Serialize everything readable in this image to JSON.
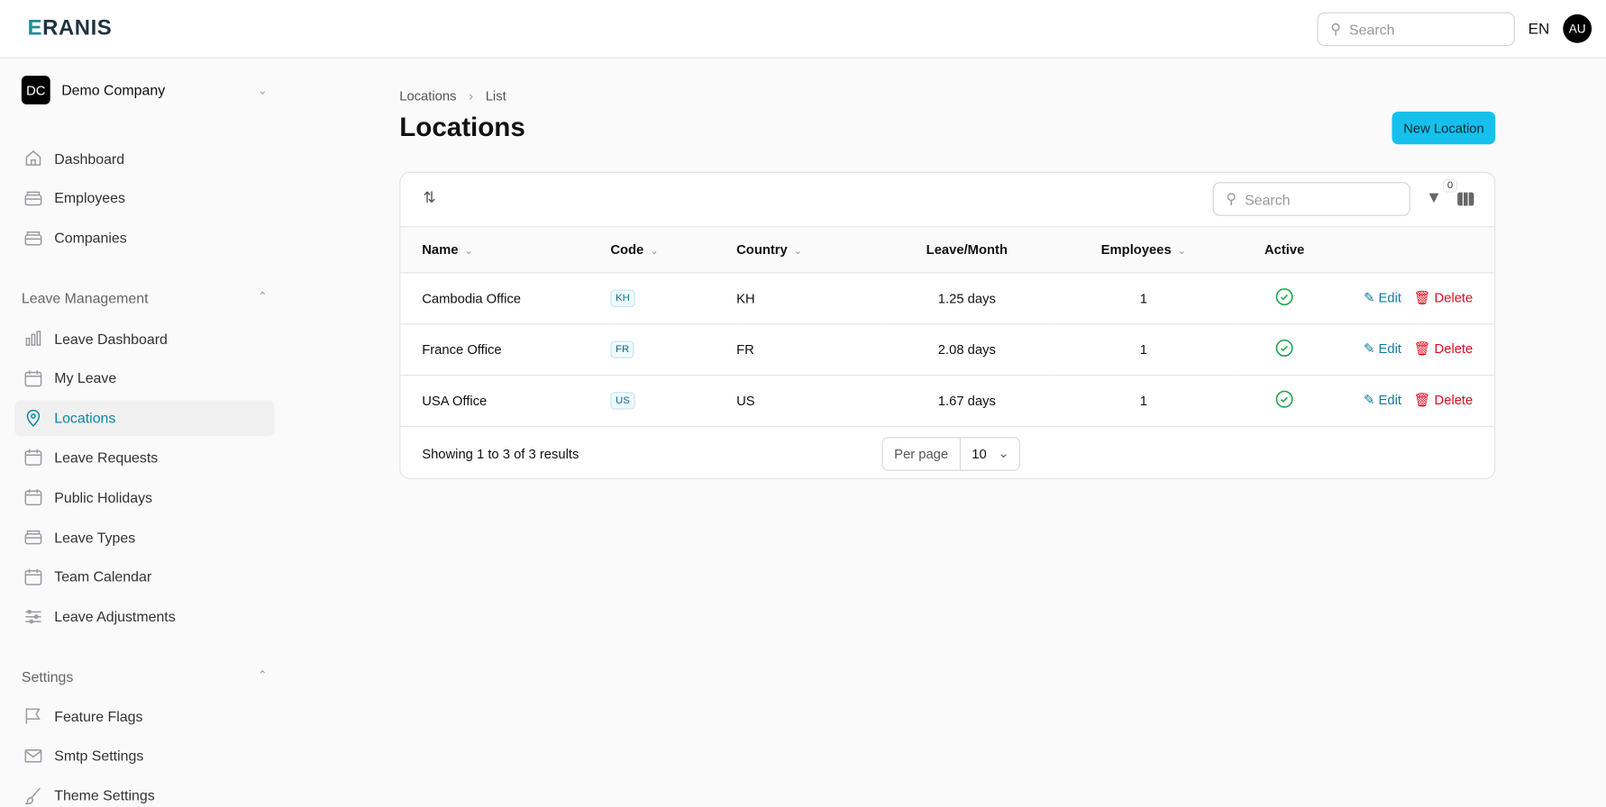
{
  "header": {
    "logo": "ERANIS",
    "search_placeholder": "Search",
    "language": "EN",
    "avatar": "AU"
  },
  "sidebar": {
    "company_initials": "DC",
    "company": "Demo Company",
    "items": [
      {
        "label": "Dashboard",
        "icon": "home-icon"
      },
      {
        "label": "Employees",
        "icon": "tray-icon"
      },
      {
        "label": "Companies",
        "icon": "tray-icon"
      }
    ],
    "leave_section": "Leave Management",
    "leave_items": [
      {
        "label": "Leave Dashboard",
        "icon": "bar-chart-icon"
      },
      {
        "label": "My Leave",
        "icon": "calendar-icon"
      },
      {
        "label": "Locations",
        "icon": "map-pin-icon",
        "active": true
      },
      {
        "label": "Leave Requests",
        "icon": "calendar-icon"
      },
      {
        "label": "Public Holidays",
        "icon": "calendar-icon"
      },
      {
        "label": "Leave Types",
        "icon": "tray-icon"
      },
      {
        "label": "Team Calendar",
        "icon": "calendar-icon"
      },
      {
        "label": "Leave Adjustments",
        "icon": "sliders-icon"
      }
    ],
    "settings_section": "Settings",
    "settings_items": [
      {
        "label": "Feature Flags",
        "icon": "flag-icon"
      },
      {
        "label": "Smtp Settings",
        "icon": "mail-icon"
      },
      {
        "label": "Theme Settings",
        "icon": "brush-icon"
      }
    ]
  },
  "breadcrumb": [
    "Locations",
    "List"
  ],
  "page_title": "Locations",
  "new_button": "New Location",
  "accent": "#15c1ec",
  "table": {
    "search_placeholder": "Search",
    "filter_count": "0",
    "columns": [
      "Name",
      "Code",
      "Country",
      "Leave/Month",
      "Employees",
      "Active"
    ],
    "rows": [
      {
        "name": "Cambodia Office",
        "code": "KH",
        "country": "KH",
        "leave": "1.25 days",
        "employees": "1",
        "active": true
      },
      {
        "name": "France Office",
        "code": "FR",
        "country": "FR",
        "leave": "2.08 days",
        "employees": "1",
        "active": true
      },
      {
        "name": "USA Office",
        "code": "US",
        "country": "US",
        "leave": "1.67 days",
        "employees": "1",
        "active": true
      }
    ],
    "edit": "Edit",
    "delete": "Delete",
    "footer": "Showing 1 to 3 of 3 results",
    "per_page_label": "Per page",
    "per_page": "10"
  }
}
